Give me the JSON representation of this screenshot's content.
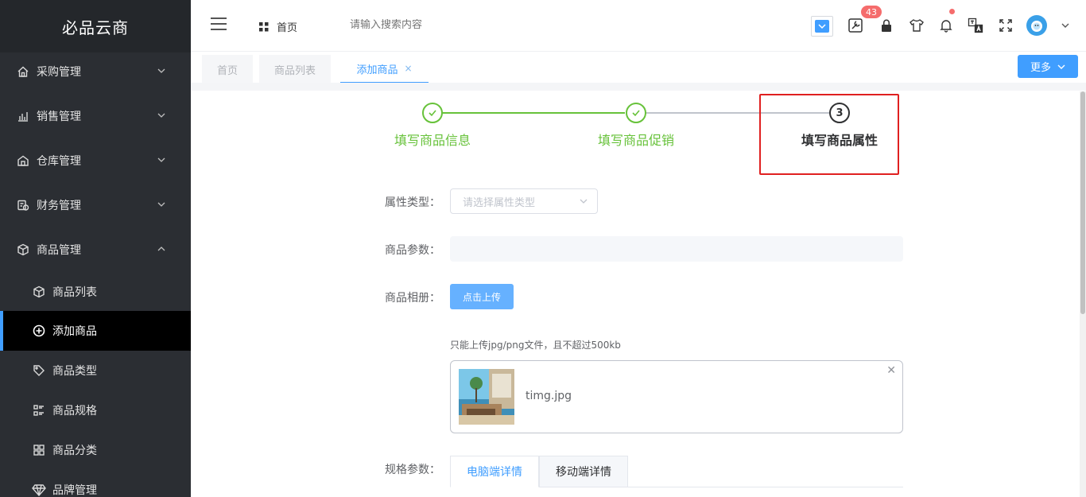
{
  "brand": "必品云商",
  "sidebar": {
    "menus": [
      {
        "label": "采购管理",
        "icon": "home-icon"
      },
      {
        "label": "销售管理",
        "icon": "chart-icon"
      },
      {
        "label": "仓库管理",
        "icon": "warehouse-icon"
      },
      {
        "label": "财务管理",
        "icon": "finance-icon"
      },
      {
        "label": "商品管理",
        "icon": "box-icon"
      }
    ],
    "subitems": [
      {
        "label": "商品列表",
        "icon": "box-icon"
      },
      {
        "label": "添加商品",
        "icon": "plus-circle-icon"
      },
      {
        "label": "商品类型",
        "icon": "tag-icon"
      },
      {
        "label": "商品规格",
        "icon": "spec-icon"
      },
      {
        "label": "商品分类",
        "icon": "grid-icon"
      },
      {
        "label": "品牌管理",
        "icon": "diamond-icon"
      }
    ]
  },
  "header": {
    "home_label": "首页",
    "search_placeholder": "请输入搜索内容",
    "badge_count": "43"
  },
  "tabs": [
    {
      "label": "首页"
    },
    {
      "label": "商品列表"
    },
    {
      "label": "添加商品"
    }
  ],
  "more_label": "更多",
  "steps": [
    {
      "label": "填写商品信息",
      "status": "done"
    },
    {
      "label": "填写商品促销",
      "status": "done"
    },
    {
      "label": "填写商品属性",
      "status": "current",
      "number": "3"
    }
  ],
  "form": {
    "attr_type_label": "属性类型：",
    "attr_type_placeholder": "请选择属性类型",
    "params_label": "商品参数：",
    "album_label": "商品相册：",
    "upload_label": "点击上传",
    "upload_tip": "只能上传jpg/png文件，且不超过500kb",
    "file_name": "timg.jpg",
    "spec_label": "规格参数：",
    "spec_tabs": [
      "电脑端详情",
      "移动端详情"
    ]
  },
  "colors": {
    "accent": "#409eff",
    "success": "#67c23a",
    "sidebar": "#2b2e33",
    "highlight": "#e02020"
  }
}
